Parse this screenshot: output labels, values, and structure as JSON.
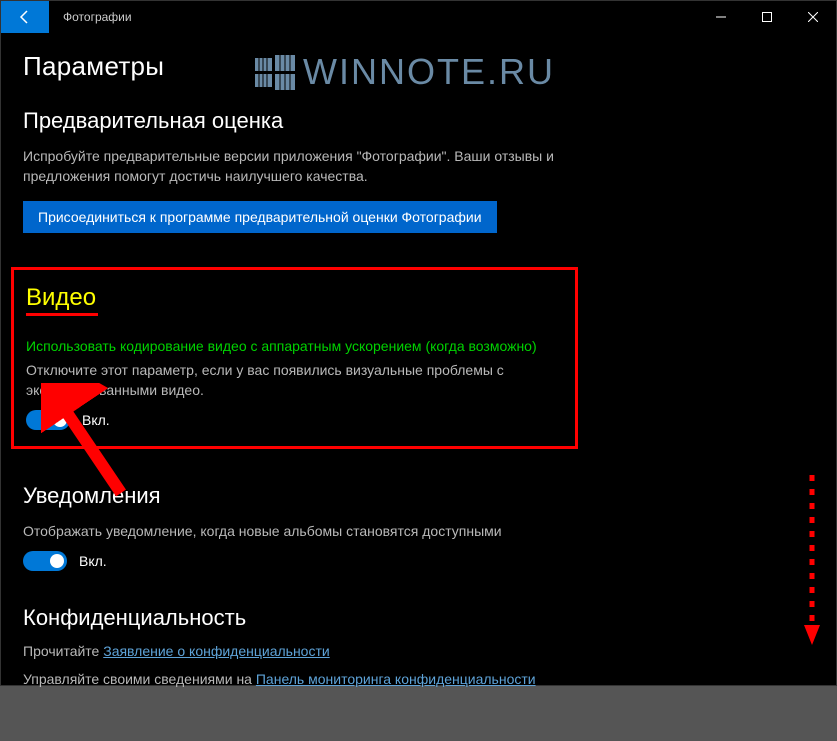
{
  "window": {
    "title": "Фотографии"
  },
  "page": {
    "heading": "Параметры"
  },
  "watermark": {
    "text": "WINNOTE.RU"
  },
  "preview": {
    "heading": "Предварительная оценка",
    "desc": "Испробуйте предварительные версии приложения \"Фотографии\". Ваши отзывы и предложения помогут достичь наилучшего качества.",
    "button": "Присоединиться к программе предварительной оценки Фотографии"
  },
  "video": {
    "heading": "Видео",
    "setting_title": "Использовать кодирование видео с аппаратным ускорением (когда возможно)",
    "setting_desc": "Отключите этот параметр, если у вас появились визуальные проблемы с экспортированными видео.",
    "toggle_label": "Вкл."
  },
  "notifications": {
    "heading": "Уведомления",
    "desc": "Отображать уведомление, когда новые альбомы становятся доступными",
    "toggle_label": "Вкл."
  },
  "privacy": {
    "heading": "Конфиденциальность",
    "line1_prefix": "Прочитайте ",
    "line1_link": "Заявление о конфиденциальности",
    "line2_prefix": "Управляйте своими сведениями на ",
    "line2_link": "Панель мониторинга конфиденциальности"
  }
}
